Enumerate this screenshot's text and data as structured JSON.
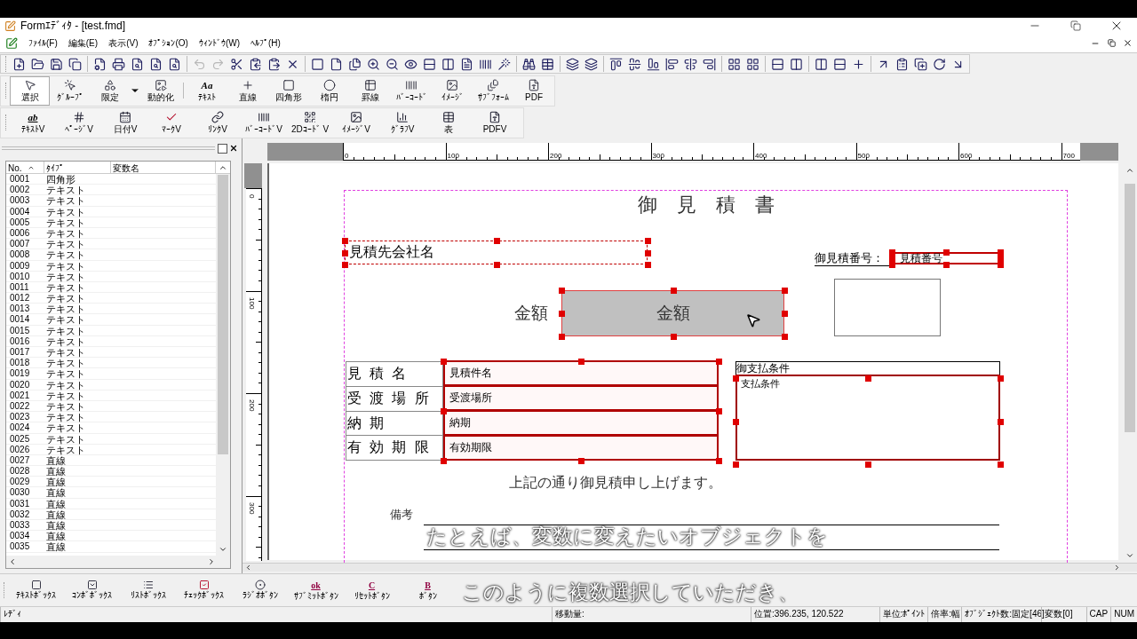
{
  "window": {
    "title": "Formｴﾃﾞｨﾀ - [test.fmd]"
  },
  "menu": [
    "ﾌｧｲﾙ(F)",
    "編集(E)",
    "表示(V)",
    "ｵﾌﾟｼｮﾝ(O)",
    "ｳｨﾝﾄﾞｳ(W)",
    "ﾍﾙﾌﾟ(H)"
  ],
  "draw_tools": [
    {
      "label": "選択",
      "selected": true
    },
    {
      "label": "ｸﾞﾙｰﾌﾟ",
      "selected": false
    },
    {
      "label": "限定",
      "selected": false
    },
    {
      "label": "動的化",
      "selected": false
    },
    {
      "label": "ﾃｷｽﾄ",
      "selected": false,
      "glyph": "Aa"
    },
    {
      "label": "直線",
      "selected": false
    },
    {
      "label": "四角形",
      "selected": false
    },
    {
      "label": "楕円",
      "selected": false
    },
    {
      "label": "罫線",
      "selected": false
    },
    {
      "label": "ﾊﾞｰｺｰﾄﾞ",
      "selected": false
    },
    {
      "label": "ｲﾒｰｼﾞ",
      "selected": false
    },
    {
      "label": "ｻﾌﾞﾌｫｰﾑ",
      "selected": false
    },
    {
      "label": "PDF",
      "selected": false
    }
  ],
  "variable_tools": [
    {
      "label": "ﾃｷｽﾄV",
      "glyph": "ab"
    },
    {
      "label": "ﾍﾟｰｼﾞV"
    },
    {
      "label": "日付V"
    },
    {
      "label": "ﾏｰｸV"
    },
    {
      "label": "ﾘﾝｸV"
    },
    {
      "label": "ﾊﾞｰｺｰﾄﾞV"
    },
    {
      "label": "2Dｺｰﾄﾞ V"
    },
    {
      "label": "ｲﾒｰｼﾞV"
    },
    {
      "label": "ｸﾞﾗﾌV"
    },
    {
      "label": "表"
    },
    {
      "label": "PDFV"
    }
  ],
  "object_list": {
    "columns": [
      "No.",
      "ﾀｲﾌﾟ",
      "変数名"
    ],
    "rows": [
      [
        "0001",
        "四角形"
      ],
      [
        "0002",
        "テキスト"
      ],
      [
        "0003",
        "テキスト"
      ],
      [
        "0004",
        "テキスト"
      ],
      [
        "0005",
        "テキスト"
      ],
      [
        "0006",
        "テキスト"
      ],
      [
        "0007",
        "テキスト"
      ],
      [
        "0008",
        "テキスト"
      ],
      [
        "0009",
        "テキスト"
      ],
      [
        "0010",
        "テキスト"
      ],
      [
        "0011",
        "テキスト"
      ],
      [
        "0012",
        "テキスト"
      ],
      [
        "0013",
        "テキスト"
      ],
      [
        "0014",
        "テキスト"
      ],
      [
        "0015",
        "テキスト"
      ],
      [
        "0016",
        "テキスト"
      ],
      [
        "0017",
        "テキスト"
      ],
      [
        "0018",
        "テキスト"
      ],
      [
        "0019",
        "テキスト"
      ],
      [
        "0020",
        "テキスト"
      ],
      [
        "0021",
        "テキスト"
      ],
      [
        "0022",
        "テキスト"
      ],
      [
        "0023",
        "テキスト"
      ],
      [
        "0024",
        "テキスト"
      ],
      [
        "0025",
        "テキスト"
      ],
      [
        "0026",
        "テキスト"
      ],
      [
        "0027",
        "直線"
      ],
      [
        "0028",
        "直線"
      ],
      [
        "0029",
        "直線"
      ],
      [
        "0030",
        "直線"
      ],
      [
        "0031",
        "直線"
      ],
      [
        "0032",
        "直線"
      ],
      [
        "0033",
        "直線"
      ],
      [
        "0034",
        "直線"
      ],
      [
        "0035",
        "直線"
      ]
    ]
  },
  "rulers": {
    "horizontal": [
      "0",
      "100",
      "200",
      "300",
      "400",
      "500",
      "600",
      "700"
    ],
    "vertical": [
      "0",
      "100",
      "200",
      "300"
    ]
  },
  "canvas": {
    "objects": [
      {
        "kind": "title",
        "text": "御　見　積　書",
        "selected": false
      },
      {
        "kind": "text-box",
        "text": "見積先会社名",
        "selected": true
      },
      {
        "kind": "underlined-label",
        "text": "御見積番号：",
        "selected": false
      },
      {
        "kind": "text-box",
        "text": "見積番号",
        "selected": true
      },
      {
        "kind": "label",
        "text": "金額",
        "selected": false
      },
      {
        "kind": "shaded-box",
        "text": "金額",
        "selected": true
      },
      {
        "kind": "rect",
        "selected": false
      },
      {
        "kind": "table",
        "selected": true,
        "rows": [
          {
            "label": "見 積 名",
            "value": "見積件名"
          },
          {
            "label": "受 渡 場 所",
            "value": "受渡場所"
          },
          {
            "label": "納 期",
            "value": "納期"
          },
          {
            "label": "有 効 期 限",
            "value": "有効期限"
          }
        ]
      },
      {
        "kind": "framed-box",
        "header": "御支払条件",
        "text": "支払条件",
        "selected": true
      },
      {
        "kind": "label",
        "text": "上記の通り御見積申し上げます。",
        "selected": false
      },
      {
        "kind": "label",
        "text": "備考",
        "selected": false
      },
      {
        "kind": "line",
        "selected": false
      },
      {
        "kind": "line",
        "selected": false
      }
    ]
  },
  "form_controls": [
    {
      "label": "ﾃｷｽﾄﾎﾞｯｸｽ"
    },
    {
      "label": "ｺﾝﾎﾞﾎﾞｯｸｽ"
    },
    {
      "label": "ﾘｽﾄﾎﾞｯｸｽ"
    },
    {
      "label": "ﾁｪｯｸﾎﾞｯｸｽ"
    },
    {
      "label": "ﾗｼﾞｵﾎﾞﾀﾝ"
    },
    {
      "label": "ｻﾌﾞﾐｯﾄﾎﾞﾀﾝ",
      "glyph": "ok"
    },
    {
      "label": "ﾘｾｯﾄﾎﾞﾀﾝ",
      "glyph": "C"
    },
    {
      "label": "ﾎﾞﾀﾝ",
      "glyph": "B"
    }
  ],
  "status_bar": [
    "ﾚﾃﾞｨ",
    "移動量:",
    "位置:396.235, 120.522",
    "単位:ﾎﾟｲﾝﾄ",
    "倍率:幅",
    "ｵﾌﾞｼﾞｪｸﾄ数:固定[46]",
    "変数[0]",
    "CAP",
    "NUM"
  ],
  "captions": [
    "たとえば、変数に変えたいオブジェクトを",
    "このように複数選択していただき、"
  ]
}
